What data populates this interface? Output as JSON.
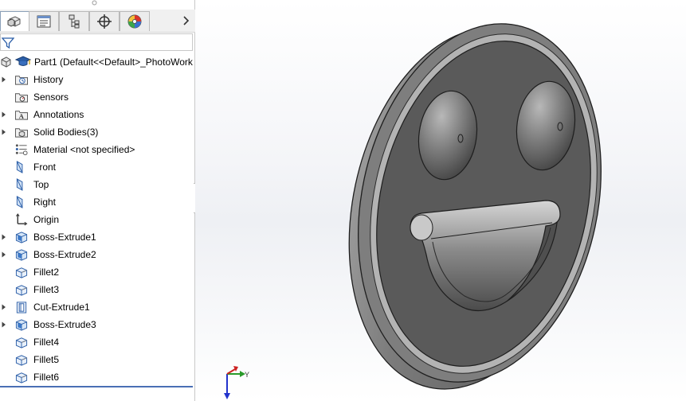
{
  "tabs": [
    {
      "name": "feature-manager",
      "icon": "feature-manager-icon"
    },
    {
      "name": "property-manager",
      "icon": "property-manager-icon"
    },
    {
      "name": "configuration-manager",
      "icon": "configuration-manager-icon"
    },
    {
      "name": "dimxpert-manager",
      "icon": "dimxpert-icon"
    },
    {
      "name": "display-manager",
      "icon": "display-manager-icon"
    }
  ],
  "tree": {
    "root_label": "Part1  (Default<<Default>_PhotoWork",
    "items": [
      {
        "label": "History",
        "icon": "history-folder-icon",
        "expandable": true
      },
      {
        "label": "Sensors",
        "icon": "sensors-folder-icon",
        "expandable": false
      },
      {
        "label": "Annotations",
        "icon": "annotations-folder-icon",
        "expandable": true
      },
      {
        "label": "Solid Bodies(3)",
        "icon": "solid-bodies-folder-icon",
        "expandable": true
      },
      {
        "label": "Material <not specified>",
        "icon": "material-icon",
        "expandable": false
      },
      {
        "label": "Front",
        "icon": "plane-icon",
        "expandable": false
      },
      {
        "label": "Top",
        "icon": "plane-icon",
        "expandable": false
      },
      {
        "label": "Right",
        "icon": "plane-icon",
        "expandable": false
      },
      {
        "label": "Origin",
        "icon": "origin-icon",
        "expandable": false
      },
      {
        "label": "Boss-Extrude1",
        "icon": "boss-extrude-icon",
        "expandable": true
      },
      {
        "label": "Boss-Extrude2",
        "icon": "boss-extrude-icon",
        "expandable": true
      },
      {
        "label": "Fillet2",
        "icon": "fillet-icon",
        "expandable": false
      },
      {
        "label": "Fillet3",
        "icon": "fillet-icon",
        "expandable": false
      },
      {
        "label": "Cut-Extrude1",
        "icon": "cut-extrude-icon",
        "expandable": true
      },
      {
        "label": "Boss-Extrude3",
        "icon": "boss-extrude-icon",
        "expandable": true
      },
      {
        "label": "Fillet4",
        "icon": "fillet-icon",
        "expandable": false
      },
      {
        "label": "Fillet5",
        "icon": "fillet-icon",
        "expandable": false
      },
      {
        "label": "Fillet6",
        "icon": "fillet-icon",
        "expandable": false
      }
    ]
  },
  "triad": {
    "y_label": "Y"
  },
  "colors": {
    "model_face": "#5a5a5a",
    "model_rim": "#8c8c8c",
    "selection_line": "#4a6fb5"
  }
}
